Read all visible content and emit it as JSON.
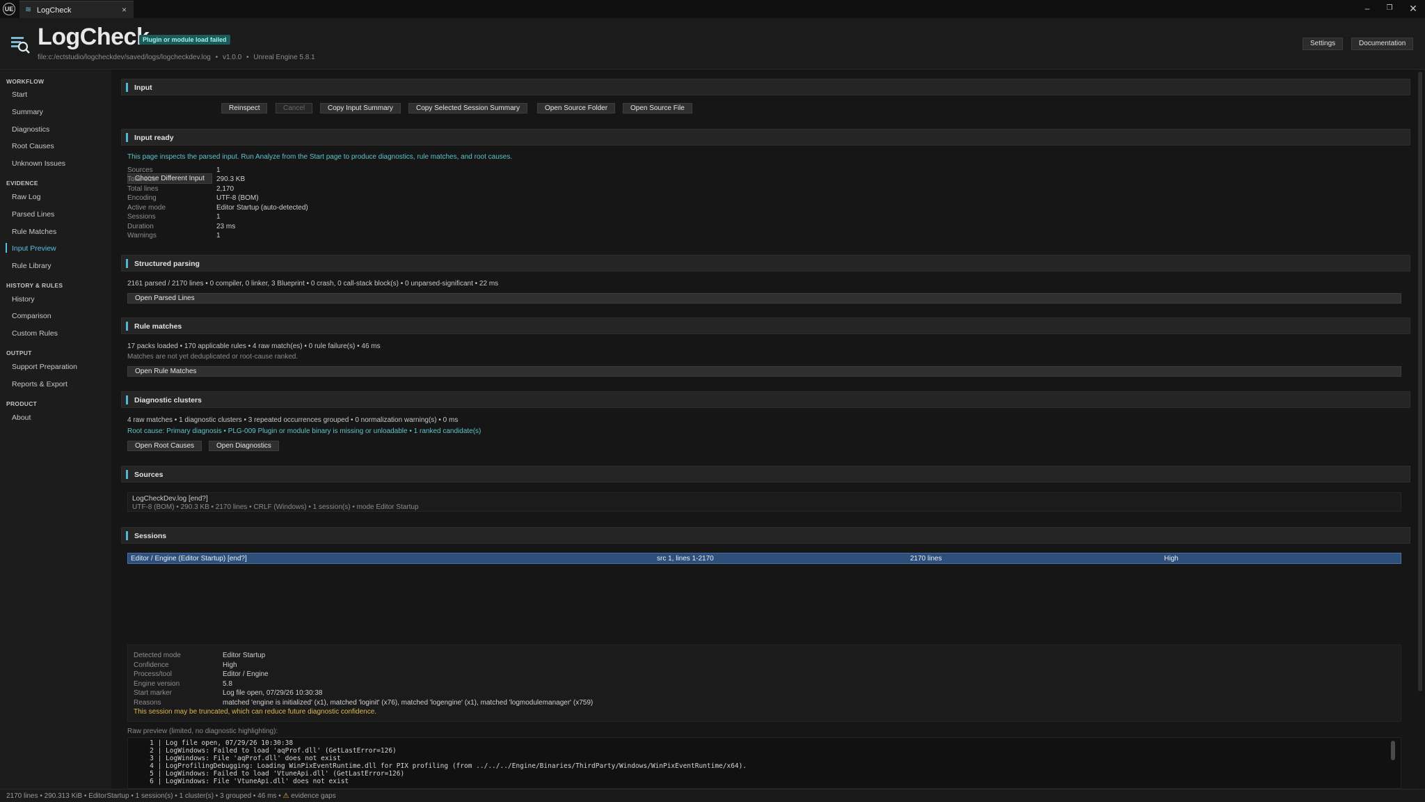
{
  "window": {
    "logo": "UE",
    "tab_title": "LogCheck",
    "tab_close": "×",
    "min": "–",
    "max": "❐",
    "close": "✕"
  },
  "header": {
    "app_name": "LogCheck",
    "badge": "Plugin or module load failed",
    "file_path": "file:c:/ectstudio/logcheckdev/saved/logs/logcheckdev.log",
    "version": "v1.0.0",
    "engine": "Unreal Engine 5.8.1",
    "sep": "•",
    "settings_label": "Settings",
    "documentation_label": "Documentation"
  },
  "sidebar": {
    "sections": [
      {
        "title": "WORKFLOW",
        "items": [
          "Start",
          "Summary",
          "Diagnostics",
          "Root Causes",
          "Unknown Issues"
        ]
      },
      {
        "title": "EVIDENCE",
        "items": [
          "Raw Log",
          "Parsed Lines",
          "Rule Matches",
          "Input Preview",
          "Rule Library"
        ]
      },
      {
        "title": "HISTORY & RULES",
        "items": [
          "History",
          "Comparison",
          "Custom Rules"
        ]
      },
      {
        "title": "OUTPUT",
        "items": [
          "Support Preparation",
          "Reports & Export"
        ]
      },
      {
        "title": "PRODUCT",
        "items": [
          "About"
        ]
      }
    ],
    "active_item": "Input Preview"
  },
  "input": {
    "title": "Input",
    "buttons": [
      "Choose Different Input",
      "Reinspect",
      "Cancel",
      "Copy Input Summary",
      "Copy Selected Session Summary",
      "Open Source Folder",
      "Open Source File"
    ]
  },
  "input_ready": {
    "title": "Input ready",
    "note": "This page inspects the parsed input. Run Analyze from the Start page to produce diagnostics, rule matches, and root causes.",
    "rows": [
      {
        "label": "Sources",
        "value": "1"
      },
      {
        "label": "Total size",
        "value": "290.3 KB"
      },
      {
        "label": "Total lines",
        "value": "2,170"
      },
      {
        "label": "Encoding",
        "value": "UTF-8 (BOM)"
      },
      {
        "label": "Active mode",
        "value": "Editor Startup (auto-detected)"
      },
      {
        "label": "Sessions",
        "value": "1"
      },
      {
        "label": "Duration",
        "value": "23 ms"
      },
      {
        "label": "Warnings",
        "value": "1"
      }
    ]
  },
  "structured_parsing": {
    "title": "Structured parsing",
    "summary": "2161 parsed / 2170 lines  •  0 compiler, 0 linker, 3 Blueprint  •  0 crash, 0 call-stack block(s)  •  0 unparsed-significant  •  22 ms",
    "button": "Open Parsed Lines"
  },
  "rule_matches": {
    "title": "Rule matches",
    "summary": "17 packs loaded  •  170 applicable rules  •  4 raw match(es)  •  0 rule failure(s)  •  46 ms",
    "note": "Matches are not yet deduplicated or root-cause ranked.",
    "button": "Open Rule Matches"
  },
  "diagnostic_clusters": {
    "title": "Diagnostic clusters",
    "summary": "4 raw matches  •  1 diagnostic clusters  •  3 repeated occurrences grouped  •  0 normalization warning(s)  •  0 ms",
    "root_cause": "Root cause: Primary diagnosis  •  PLG-009 Plugin or module binary is missing or unloadable  •  1 ranked candidate(s)",
    "buttons": [
      "Open Root Causes",
      "Open Diagnostics"
    ]
  },
  "sources": {
    "title": "Sources",
    "name": "LogCheckDev.log [end?]",
    "detail": "UTF-8 (BOM)  •  290.3 KB  •  2170 lines  •  CRLF (Windows)  •  1 session(s)  •  mode Editor Startup"
  },
  "sessions": {
    "title": "Sessions",
    "row": {
      "name": "Editor / Engine (Editor Startup)  [end?]",
      "range": "src 1, lines 1-2170",
      "lines": "2170 lines",
      "confidence": "High"
    },
    "details": [
      {
        "label": "Detected mode",
        "value": "Editor Startup"
      },
      {
        "label": "Confidence",
        "value": "High"
      },
      {
        "label": "Process/tool",
        "value": "Editor / Engine"
      },
      {
        "label": "Engine version",
        "value": "5.8"
      },
      {
        "label": "Start marker",
        "value": "Log file open, 07/29/26 10:30:38"
      },
      {
        "label": "Reasons",
        "value": "matched 'engine is initialized' (x1), matched 'loginit' (x76), matched 'logengine' (x1), matched 'logmodulemanager' (x759)"
      }
    ],
    "warning": "This session may be truncated, which can reduce future diagnostic confidence."
  },
  "raw_preview": {
    "label": "Raw preview (limited, no diagnostic highlighting):",
    "lines": [
      "   1 | Log file open, 07/29/26 10:30:38",
      "   2 | LogWindows: Failed to load 'aqProf.dll' (GetLastError=126)",
      "   3 | LogWindows: File 'aqProf.dll' does not exist",
      "   4 | LogProfilingDebugging: Loading WinPixEventRuntime.dll for PIX profiling (from ../../../Engine/Binaries/ThirdParty/Windows/WinPixEventRuntime/x64).",
      "   5 | LogWindows: Failed to load 'VtuneApi.dll' (GetLastError=126)",
      "   6 | LogWindows: File 'VtuneApi.dll' does not exist"
    ]
  },
  "statusbar": {
    "text": "2170 lines  •  290.313 KiB  •  EditorStartup  •  1 session(s)  •  1 cluster(s)  •  3 grouped  •  46 ms  •",
    "warn_icon": "⚠",
    "warn_text": "evidence gaps"
  },
  "colors": {
    "accent": "#4fb8d6",
    "active_nav": "#58c2e0",
    "badge_bg": "#1d5b5b",
    "selection": "#2e4f7a",
    "warning": "#e0b84a"
  }
}
